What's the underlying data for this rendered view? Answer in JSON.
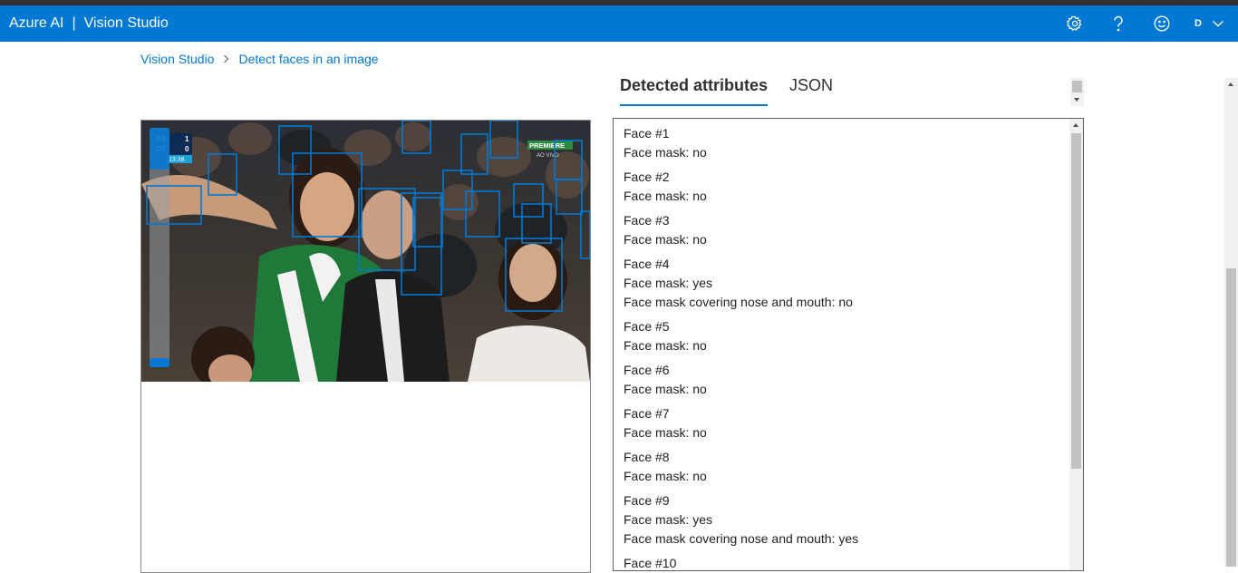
{
  "header": {
    "brand_main": "Azure AI",
    "brand_separator": "|",
    "brand_product": "Vision Studio",
    "avatar_initial": "D",
    "icons": [
      "settings-icon",
      "help-icon",
      "feedback-smiley-icon",
      "chevron-down-icon"
    ],
    "bar_color": "#0078d4"
  },
  "breadcrumb": {
    "items": [
      "Vision Studio",
      "Detect faces in an image"
    ]
  },
  "image": {
    "overlay_badge": "PREMIERE",
    "overlay_badge_sub": "AO VIVO",
    "scoreboard": [
      {
        "team": "AS",
        "score": "1"
      },
      {
        "team": "OT",
        "score": "0"
      }
    ],
    "clock": "13:38",
    "box_color": "#0078d4"
  },
  "tabs": [
    {
      "label": "Detected attributes",
      "active": true
    },
    {
      "label": "JSON",
      "active": false
    }
  ],
  "faces": [
    {
      "title": "Face #1",
      "lines": [
        "Face mask: no"
      ]
    },
    {
      "title": "Face #2",
      "lines": [
        "Face mask: no"
      ]
    },
    {
      "title": "Face #3",
      "lines": [
        "Face mask: no"
      ]
    },
    {
      "title": "Face #4",
      "lines": [
        "Face mask: yes",
        "Face mask covering nose and mouth: no"
      ]
    },
    {
      "title": "Face #5",
      "lines": [
        "Face mask: no"
      ]
    },
    {
      "title": "Face #6",
      "lines": [
        "Face mask: no"
      ]
    },
    {
      "title": "Face #7",
      "lines": [
        "Face mask: no"
      ]
    },
    {
      "title": "Face #8",
      "lines": [
        "Face mask: no"
      ]
    },
    {
      "title": "Face #9",
      "lines": [
        "Face mask: yes",
        "Face mask covering nose and mouth: yes"
      ]
    },
    {
      "title": "Face #10",
      "lines": []
    }
  ]
}
